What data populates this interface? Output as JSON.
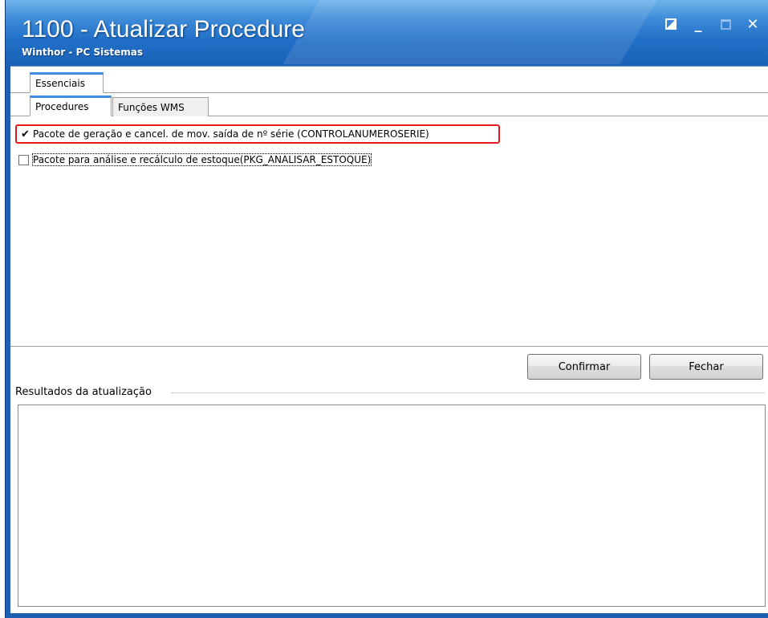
{
  "window": {
    "title": "1100 - Atualizar Procedure",
    "subtitle": "Winthor - PC Sistemas",
    "controls": {
      "restore_icon": "restore-icon",
      "minimize_label": "_",
      "maximize_icon": "maximize-icon",
      "close_label": "✕"
    }
  },
  "tabs": {
    "primary": [
      {
        "label": "Essenciais",
        "active": true
      }
    ],
    "secondary": [
      {
        "label": "Procedures",
        "active": true
      },
      {
        "label": "Funções WMS",
        "active": false
      }
    ]
  },
  "procedures": [
    {
      "label": "Pacote de geração e cancel. de mov. saída de nº série (CONTROLANUMEROSERIE)",
      "checked": true,
      "highlighted": true
    },
    {
      "label": "Pacote para análise e recálculo de estoque(PKG_ANALISAR_ESTOQUE)",
      "checked": false,
      "focused": true
    }
  ],
  "buttons": {
    "confirm": "Confirmar",
    "close": "Fechar"
  },
  "results": {
    "label": "Resultados da atualização",
    "content": ""
  },
  "colors": {
    "titlebar": "#2170c8",
    "highlight": "#e41b1b",
    "tab_accent": "#3e8ee6"
  }
}
